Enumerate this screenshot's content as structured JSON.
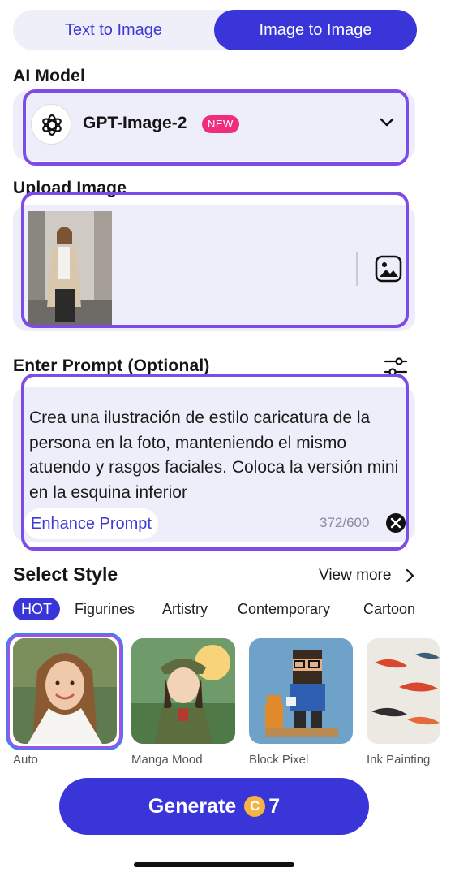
{
  "tabs": [
    {
      "label": "Text to Image",
      "active": false
    },
    {
      "label": "Image to Image",
      "active": true
    }
  ],
  "ai_model": {
    "section_label": "AI Model",
    "name": "GPT-Image-2",
    "badge": "NEW",
    "logo_icon": "openai-logo-icon",
    "dropdown_icon": "chevron-down-icon"
  },
  "upload": {
    "section_label": "Upload Image",
    "upload_icon": "image-upload-icon"
  },
  "prompt": {
    "section_label": "Enter Prompt (Optional)",
    "text": "Crea una ilustración de estilo caricatura de la persona en la foto, manteniendo el mismo atuendo y rasgos faciales. Coloca la versión mini en la esquina inferior",
    "enhance_label": "Enhance Prompt",
    "counter": "372/600",
    "settings_icon": "sliders-icon",
    "clear_icon": "close-icon"
  },
  "style": {
    "title": "Select Style",
    "view_more": "View more",
    "categories": [
      "HOT",
      "Figurines",
      "Artistry",
      "Contemporary",
      "Cartoon"
    ],
    "active_category": "HOT",
    "items": [
      {
        "label": "Auto",
        "selected": true
      },
      {
        "label": "Manga Mood",
        "selected": false
      },
      {
        "label": "Block Pixel",
        "selected": false
      },
      {
        "label": "Ink Painting",
        "selected": false
      }
    ]
  },
  "generate": {
    "label": "Generate",
    "coin_symbol": "C",
    "cost": "7"
  },
  "colors": {
    "accent": "#3a35d8",
    "highlight_frame": "#7c4ce8",
    "badge": "#ee2d7e",
    "card_bg": "#eeeefa"
  }
}
